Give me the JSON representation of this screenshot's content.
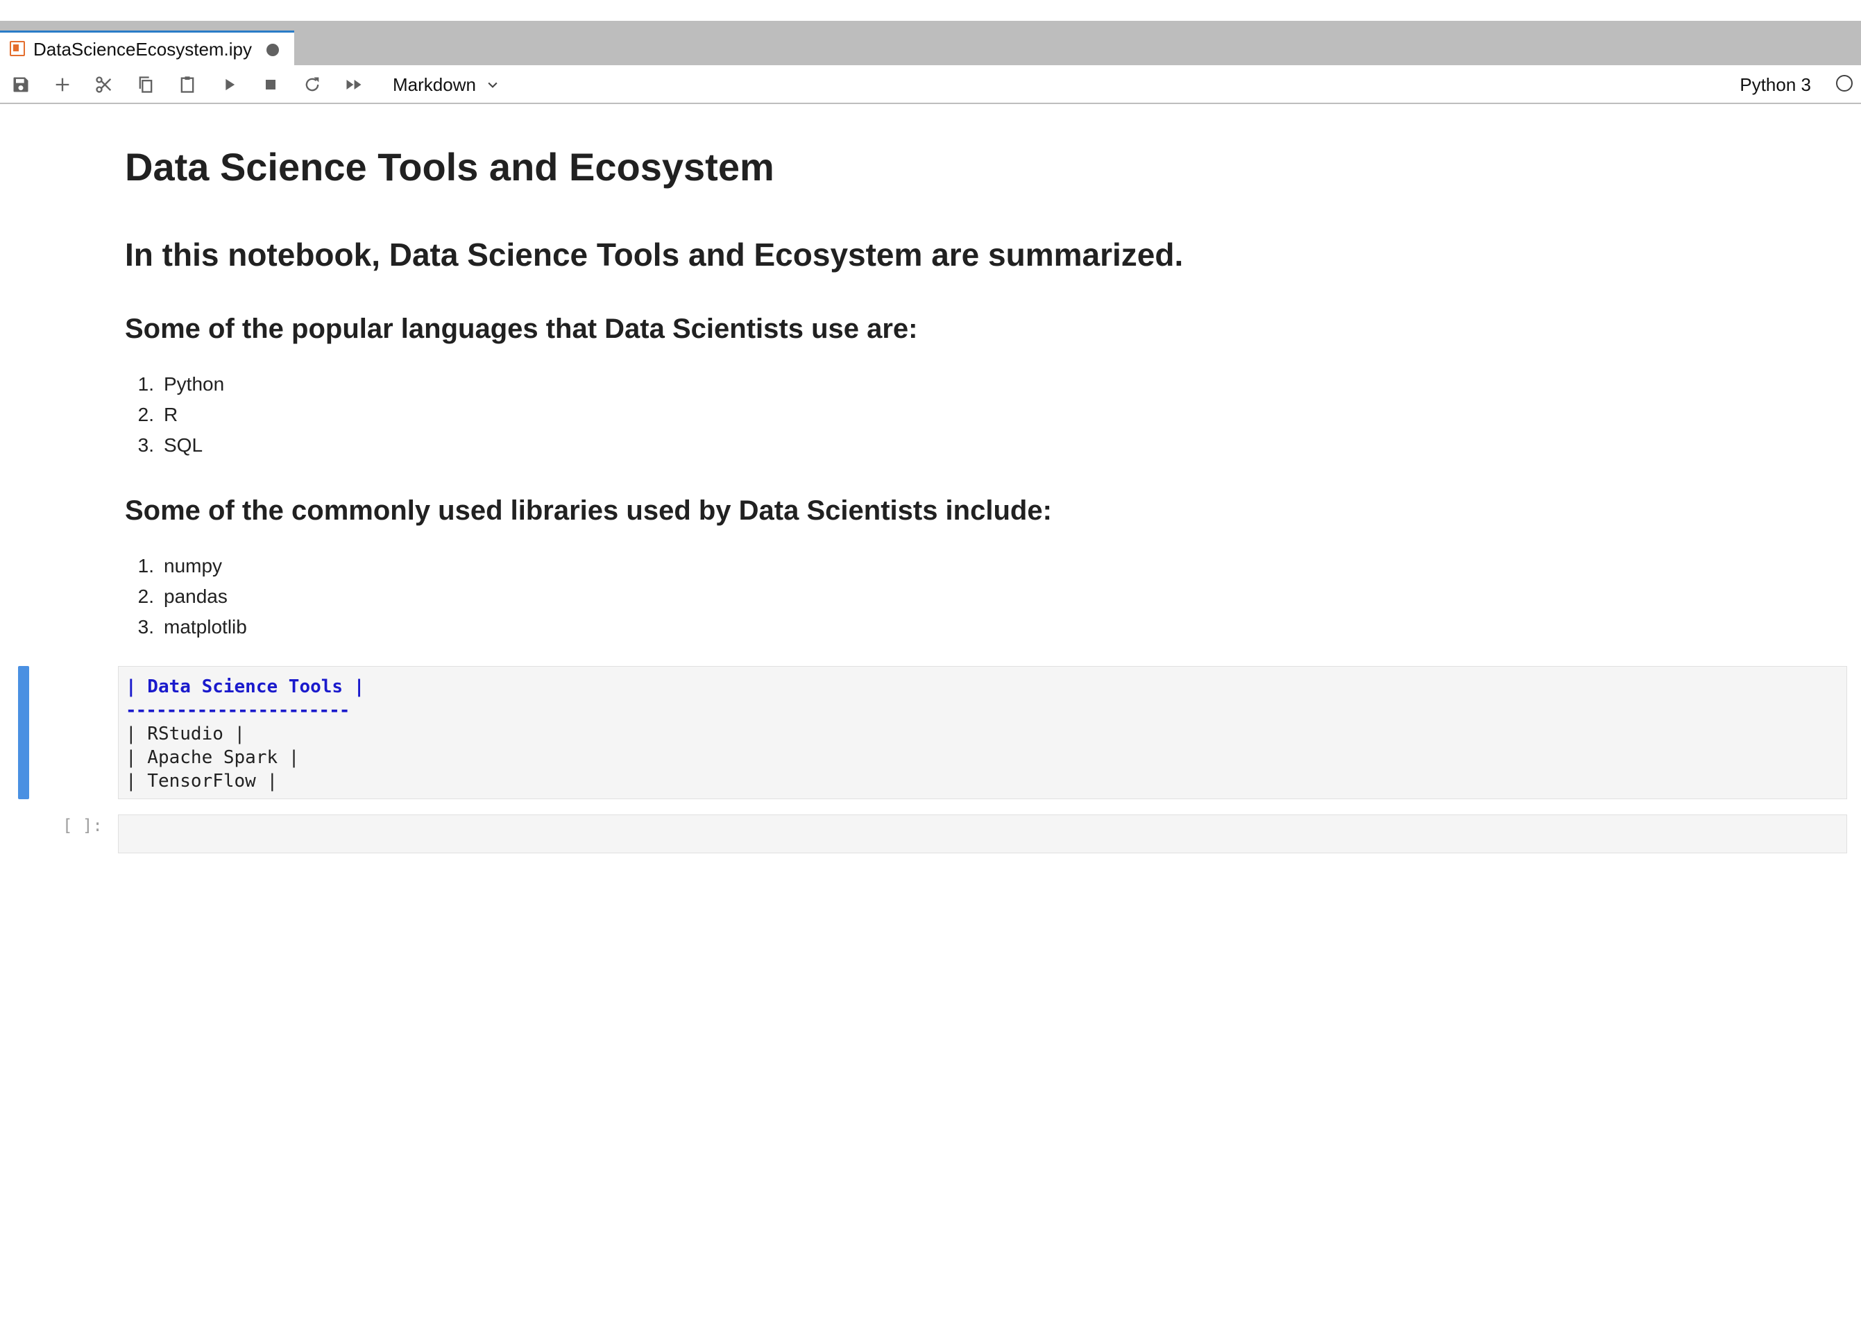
{
  "tab": {
    "title": "DataScienceEcosystem.ipy",
    "icon": "notebook-icon",
    "unsaved_indicator": "dirty-dot-icon"
  },
  "toolbar": {
    "buttons": [
      "save-icon",
      "add-cell-icon",
      "cut-icon",
      "copy-icon",
      "paste-icon",
      "run-icon",
      "stop-icon",
      "restart-icon",
      "run-all-icon"
    ],
    "cell_type": "Markdown",
    "kernel_name": "Python 3",
    "kernel_status": "idle"
  },
  "notebook": {
    "h1": "Data Science Tools and Ecosystem",
    "h2": "In this notebook, Data Science Tools and Ecosystem are summarized.",
    "languages_heading": "Some of the popular languages that Data Scientists use are:",
    "languages": [
      "Python",
      "R",
      "SQL"
    ],
    "libraries_heading": "Some of the commonly used libraries used by Data Scientists include:",
    "libraries": [
      "numpy",
      "pandas",
      "matplotlib"
    ],
    "editing_cell": {
      "header_line": "| Data Science Tools |",
      "rule_line": "----------------------",
      "rows": [
        "| RStudio |",
        "| Apache Spark |",
        "| TensorFlow |"
      ]
    },
    "empty_cell_prompt": "[ ]:"
  },
  "colors": {
    "active_cell_bar": "#4a90e2",
    "markdown_header_blue": "#1a1acc",
    "tab_accent": "#2a7cc7",
    "notebook_icon_orange": "#e46e2e"
  }
}
